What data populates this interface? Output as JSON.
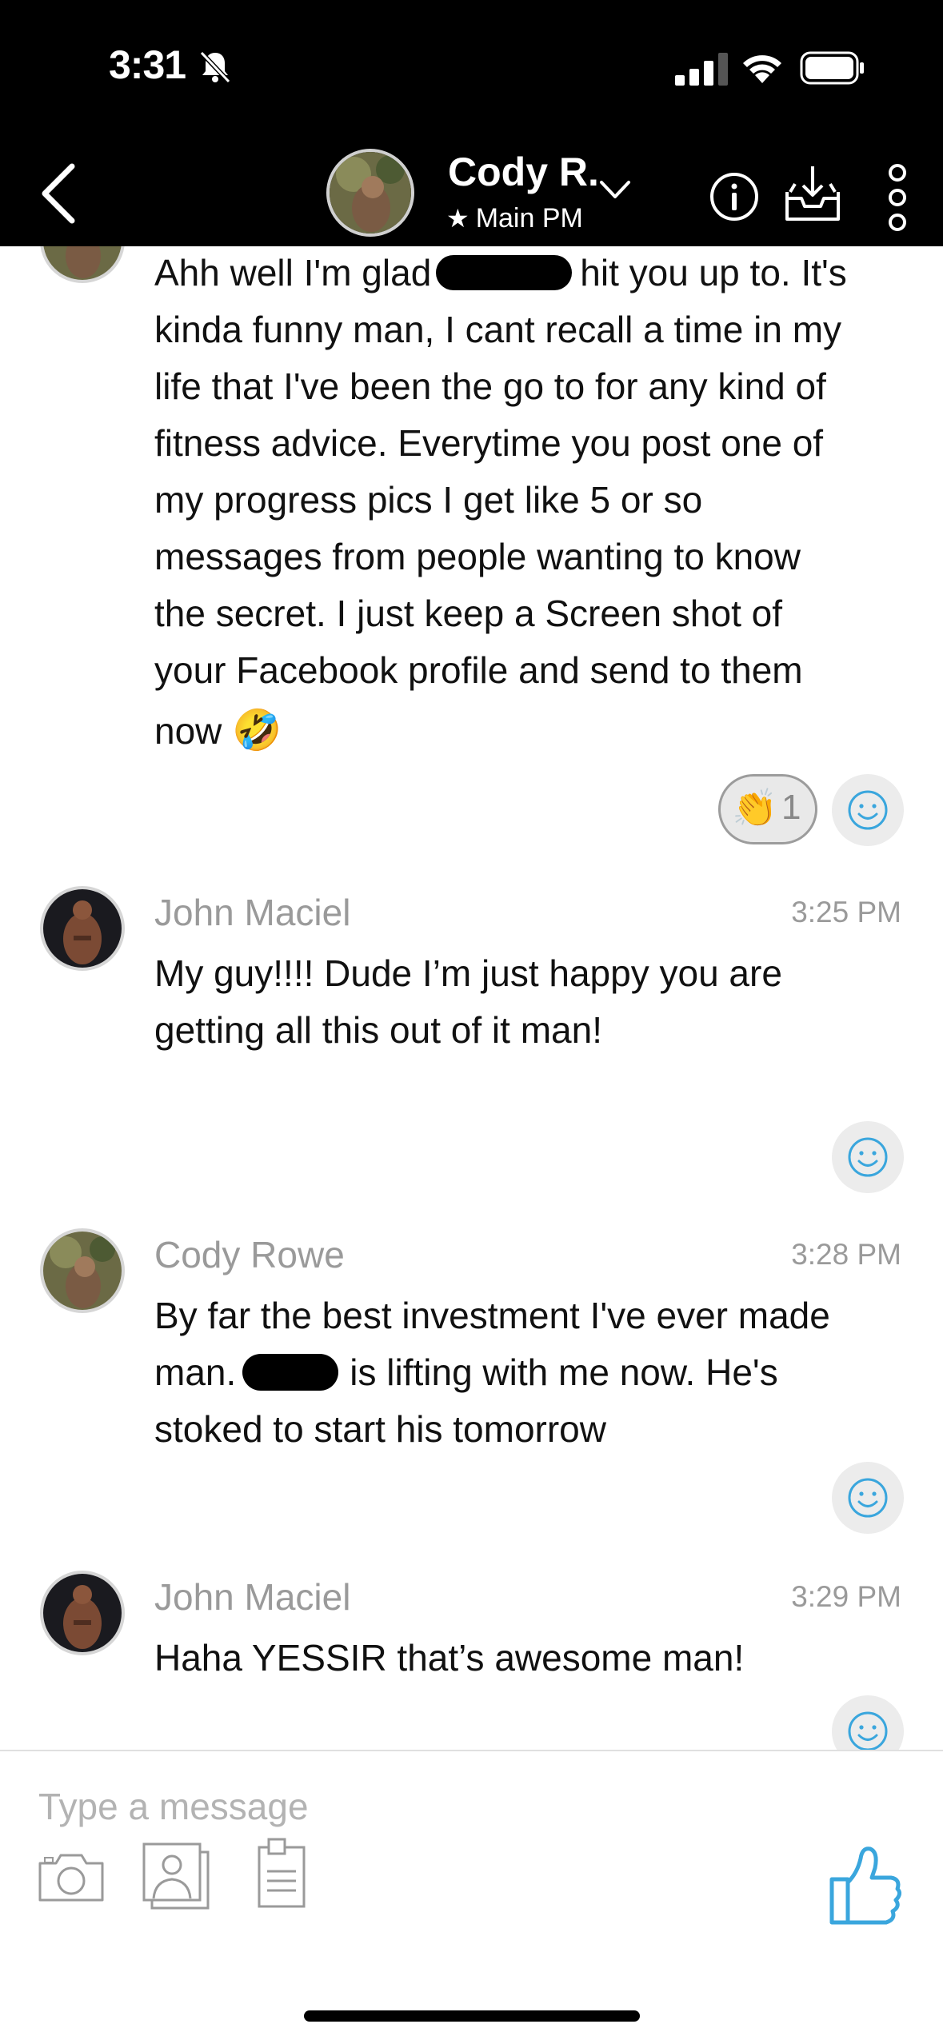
{
  "status_bar": {
    "time": "3:31"
  },
  "header": {
    "contact_name": "Cody R.",
    "sub_status": "Main PM",
    "star_icon": "★"
  },
  "messages": [
    {
      "sender": "",
      "time": "",
      "lines": [
        "Ahh well I'm glad",
        "hit you up to. It's",
        "kinda funny man, I cant recall a time in my",
        "life that I've been the go to for any kind of",
        "fitness advice. Everytime you post one of",
        "my progress pics I get like 5 or so",
        "messages from people wanting to know",
        "the secret. I just keep a Screen shot of",
        "your Facebook profile and send to them",
        "now"
      ],
      "emoji": "🤣",
      "reaction": {
        "emoji": "👏",
        "count": "1"
      }
    },
    {
      "sender": "John Maciel",
      "time": "3:25 PM",
      "lines": [
        "My guy!!!! Dude I’m just happy you are",
        "getting all this out of it man!"
      ]
    },
    {
      "sender": "Cody Rowe",
      "time": "3:28 PM",
      "lines": [
        "By far the best investment I've ever made",
        "man.",
        "is lifting with me now. He's",
        "stoked to start his tomorrow"
      ]
    },
    {
      "sender": "John Maciel",
      "time": "3:29 PM",
      "lines": [
        "Haha YESSIR that’s awesome man!"
      ]
    }
  ],
  "composer": {
    "placeholder": "Type a message"
  },
  "colors": {
    "accent": "#3aa6dd",
    "header_bg": "#000000",
    "meta_text": "#9a9a9a"
  }
}
